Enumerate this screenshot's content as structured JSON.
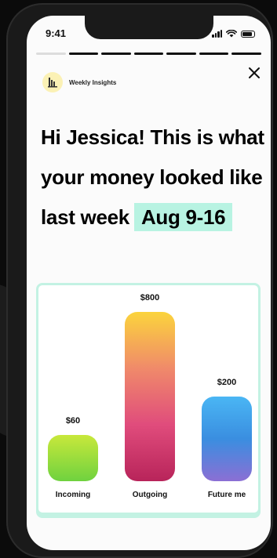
{
  "status_bar": {
    "time": "9:41"
  },
  "stories": {
    "total": 7,
    "active_index": 0
  },
  "header": {
    "brand": "Weekly Insights",
    "close_icon": "close-icon"
  },
  "headline": {
    "text": "Hi Jessica! This is what your money looked like last week",
    "date_range": "Aug 9-16"
  },
  "colors": {
    "accent_mint": "#b8f3e2",
    "incoming": [
      "#c8e83b",
      "#6fd23f"
    ],
    "outgoing": [
      "#fbd43c",
      "#f08a6a",
      "#e04c7c",
      "#b8245a"
    ],
    "future_me": [
      "#4ab6f4",
      "#3a8ee0",
      "#8b6fd4"
    ]
  },
  "chart_data": {
    "type": "bar",
    "categories": [
      "Incoming",
      "Outgoing",
      "Future me"
    ],
    "values": [
      60,
      800,
      200
    ],
    "value_labels": [
      "$60",
      "$800",
      "$200"
    ],
    "title": "",
    "xlabel": "",
    "ylabel": ""
  }
}
